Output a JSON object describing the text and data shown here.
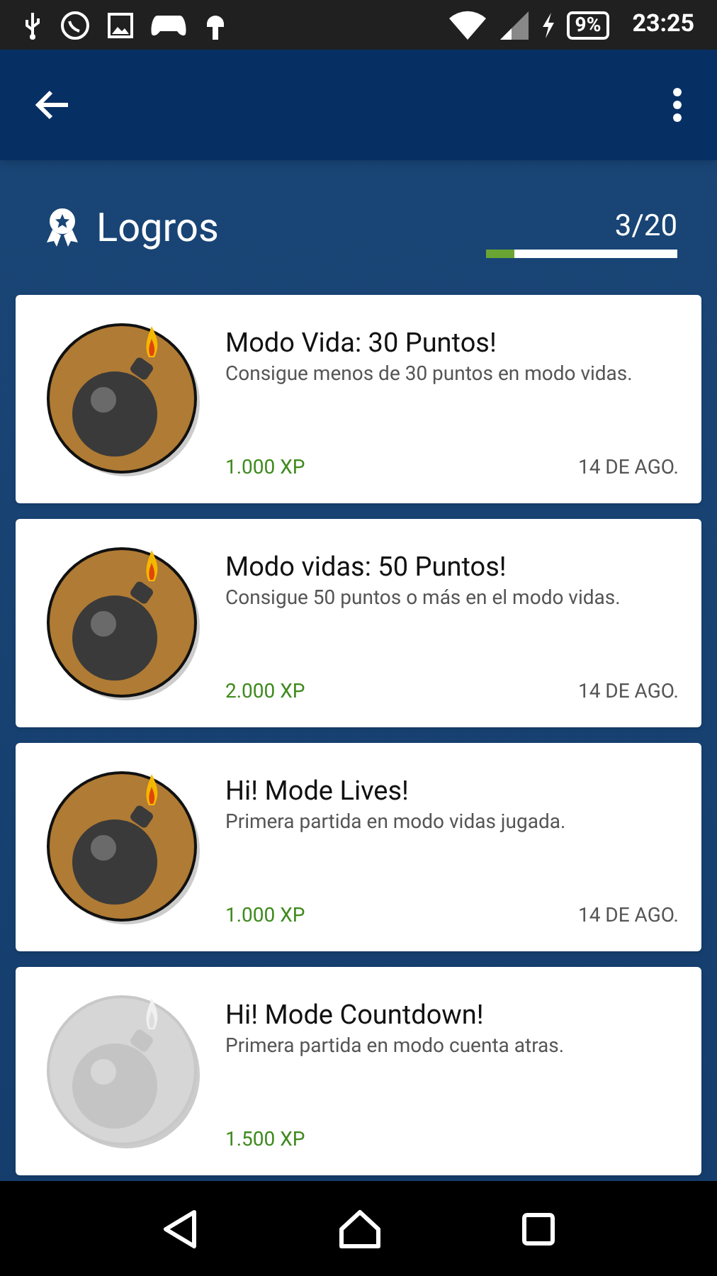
{
  "status_bar": {
    "battery": "9%",
    "time": "23:25"
  },
  "header": {
    "title": "Logros",
    "progress_text": "3/20",
    "level": 0.15
  },
  "achievements": [
    {
      "title": "Modo Vida: 30 Puntos!",
      "description": "Consigue menos de 30 puntos en modo vidas.",
      "xp": "1.000 XP",
      "date": "14 DE AGO.",
      "unlocked": true
    },
    {
      "title": "Modo vidas: 50 Puntos!",
      "description": "Consigue 50 puntos o más en el modo vidas.",
      "xp": "2.000 XP",
      "date": "14 DE AGO.",
      "unlocked": true
    },
    {
      "title": "Hi! Mode Lives!",
      "description": "Primera partida en modo vidas jugada.",
      "xp": "1.000 XP",
      "date": "14 DE AGO.",
      "unlocked": true
    },
    {
      "title": "Hi! Mode Countdown!",
      "description": "Primera partida en modo cuenta atras.",
      "xp": "1.500 XP",
      "unlocked": false
    }
  ]
}
